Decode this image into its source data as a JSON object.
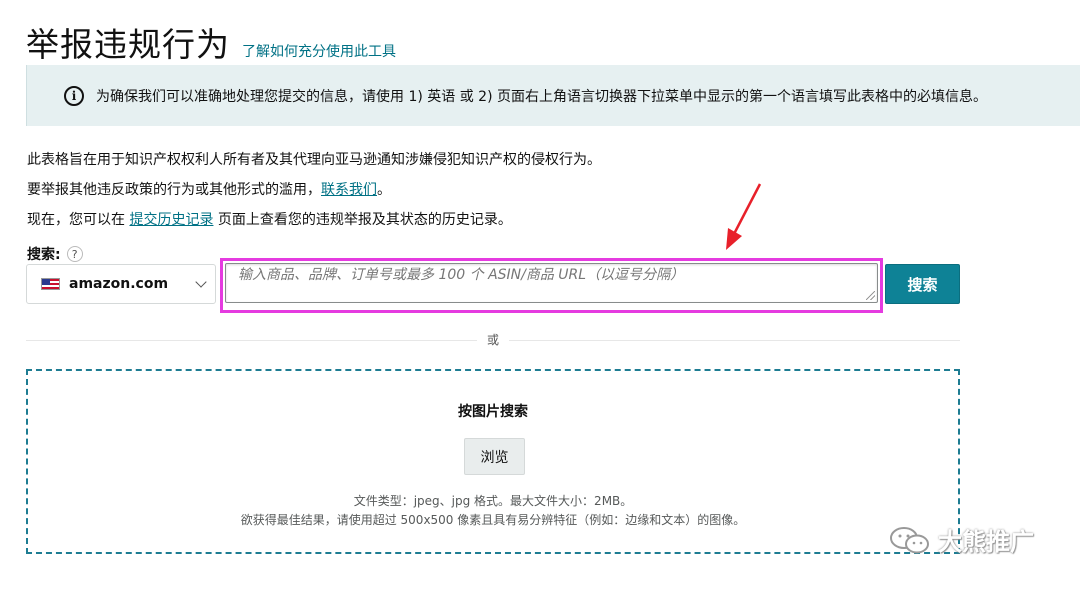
{
  "header": {
    "title": "举报违规行为",
    "help_link": "了解如何充分使用此工具"
  },
  "alert": {
    "icon": "info-icon",
    "text": "为确保我们可以准确地处理您提交的信息，请使用 1) 英语 或 2) 页面右上角语言切换器下拉菜单中显示的第一个语言填写此表格中的必填信息。"
  },
  "intro": {
    "line1": "此表格旨在用于知识产权权利人所有者及其代理向亚马逊通知涉嫌侵犯知识产权的侵权行为。",
    "line2_prefix": "要举报其他违反政策的行为或其他形式的滥用，",
    "line2_link": "联系我们",
    "line2_suffix": "。",
    "line3_prefix": "现在，您可以在 ",
    "line3_link": "提交历史记录",
    "line3_suffix": " 页面上查看您的违规举报及其状态的历史记录。"
  },
  "search": {
    "label": "搜索:",
    "help": "?",
    "marketplace": "amazon.com",
    "placeholder": "输入商品、品牌、订单号或最多 100 个 ASIN/商品 URL（以逗号分隔）",
    "button": "搜索"
  },
  "divider": {
    "or": "或"
  },
  "image_search": {
    "title": "按图片搜索",
    "browse": "浏览",
    "hint1": "文件类型：jpeg、jpg 格式。最大文件大小：2MB。",
    "hint2": "欲获得最佳结果，请使用超过 500x500 像素且具有易分辨特征（例如：边缘和文本）的图像。"
  },
  "watermark": {
    "text": "大熊推广"
  },
  "colors": {
    "accent": "#007185",
    "button": "#0e8296",
    "highlight": "#e53be0",
    "arrow": "#e8202a",
    "alert_bg": "#e6f0f1"
  }
}
